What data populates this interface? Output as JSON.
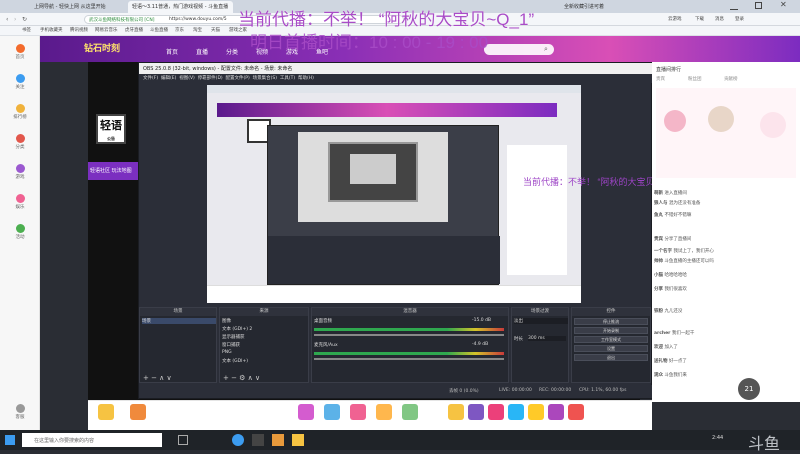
{
  "browser": {
    "tabs": [
      "上网导航 - 轻快上网 从这里开始",
      "轻语～3.11普通，热门游戏视频 - 斗鱼直播",
      "全新收藏引进可着"
    ],
    "url": "https://www.douyu.com/5",
    "site_badge": "武汉斗鱼网络科技有限公司 [CN]",
    "bookmarks": [
      "书签",
      "手机收藏夹",
      "腾讯视频",
      "网易云音乐",
      "虎牙直播",
      "斗鱼直播",
      "京东",
      "淘宝",
      "天猫",
      "游戏之家",
      "爱奇艺",
      "哔哩哔哩"
    ],
    "top_right": [
      "云游戏",
      "下载",
      "消息",
      "登录"
    ]
  },
  "overlay": {
    "line1": "当前代播：不举！ “阿秋的大宝贝~Q_1”",
    "line2": "明日首播时间：10 : 00 - 19 : 00"
  },
  "sidebar": [
    {
      "label": "首页"
    },
    {
      "label": "关注"
    },
    {
      "label": "排行榜"
    },
    {
      "label": "分类"
    },
    {
      "label": "游戏"
    },
    {
      "label": "娱乐"
    },
    {
      "label": "活动"
    },
    {
      "label": "云游戏"
    },
    {
      "label": "客服"
    }
  ],
  "site_nav": [
    "首页",
    "直播",
    "分类",
    "视频",
    "游戏",
    "鱼吧"
  ],
  "site_brand": "钻石时刻",
  "stream_logo": "轻语",
  "stream_logo_sub": "公告",
  "left_banner": "轻语社区 玩法地图",
  "obs": {
    "title": "OBS 25.0.8 (32-bit, windows) - 配置文件: 未命名 - 场景: 未命名",
    "menu": [
      "文件(F)",
      "编辑(E)",
      "视图(V)",
      "停靠部件(D)",
      "配置文件(P)",
      "场景集合(S)",
      "工具(T)",
      "帮助(H)"
    ],
    "docks": {
      "scenes": {
        "title": "场景",
        "items": [
          "场景"
        ]
      },
      "sources": {
        "title": "来源",
        "items": [
          "图像",
          "文本 (GDI+) 2",
          "显示器捕获",
          "窗口捕获",
          "PNG",
          "文本 (GDI+)"
        ]
      },
      "mixer": {
        "title": "混音器",
        "channels": [
          {
            "name": "桌面音频",
            "db": "-15.0 dB"
          },
          {
            "name": "麦克风/Aux",
            "db": "-4.9 dB"
          }
        ]
      },
      "transitions": {
        "title": "场景过渡",
        "type": "淡出",
        "duration_label": "时长",
        "duration": "300 ms"
      },
      "controls": {
        "title": "控件",
        "buttons": [
          "停止推流",
          "开始录制",
          "工作室模式",
          "设置",
          "退出"
        ]
      }
    },
    "status": [
      "丢帧 0 (0.0%)",
      "LIVE: 00:00:00",
      "REC: 00:00:00",
      "CPU: 1.1%, 60.00 fps"
    ]
  },
  "right_panel": {
    "header": "直播间排行",
    "tabs": [
      "贵宾",
      "粉丝团",
      "贡献榜"
    ],
    "chat": [
      {
        "user": "萌新",
        "text": "进入直播间"
      },
      {
        "user": "狼人与",
        "text": "混为还没有准备"
      },
      {
        "user": "鱼丸",
        "text": "不错好不错嘛"
      },
      {
        "user": "贵宾",
        "text": "分享了直播间"
      },
      {
        "user": "一个名字",
        "text": "我试上了，我们开心"
      },
      {
        "user": "帅帅",
        "text": "斗鱼直播的主播还可以吗"
      },
      {
        "user": "小猫",
        "text": "哈哈哈哈哈"
      },
      {
        "user": "分享",
        "text": "我们很喜欢"
      },
      {
        "user": "铁粉",
        "text": "九儿还没"
      },
      {
        "user": "archer",
        "text": "我们一起干"
      },
      {
        "user": "欢迎",
        "text": "加入了"
      },
      {
        "user": "送礼物",
        "text": "好一点了"
      },
      {
        "user": "观众",
        "text": "斗鱼我们来"
      }
    ],
    "badge_count": "21"
  },
  "taskbar": {
    "search_placeholder": "在这里输入你要搜索的内容",
    "time": "2:44",
    "watermark": "斗鱼"
  },
  "colors": {
    "accent": "#f36b2c",
    "overlay_text": "#a94cc7",
    "header_purple": "#7c2cc0",
    "obs_dark": "#2b2e38"
  }
}
